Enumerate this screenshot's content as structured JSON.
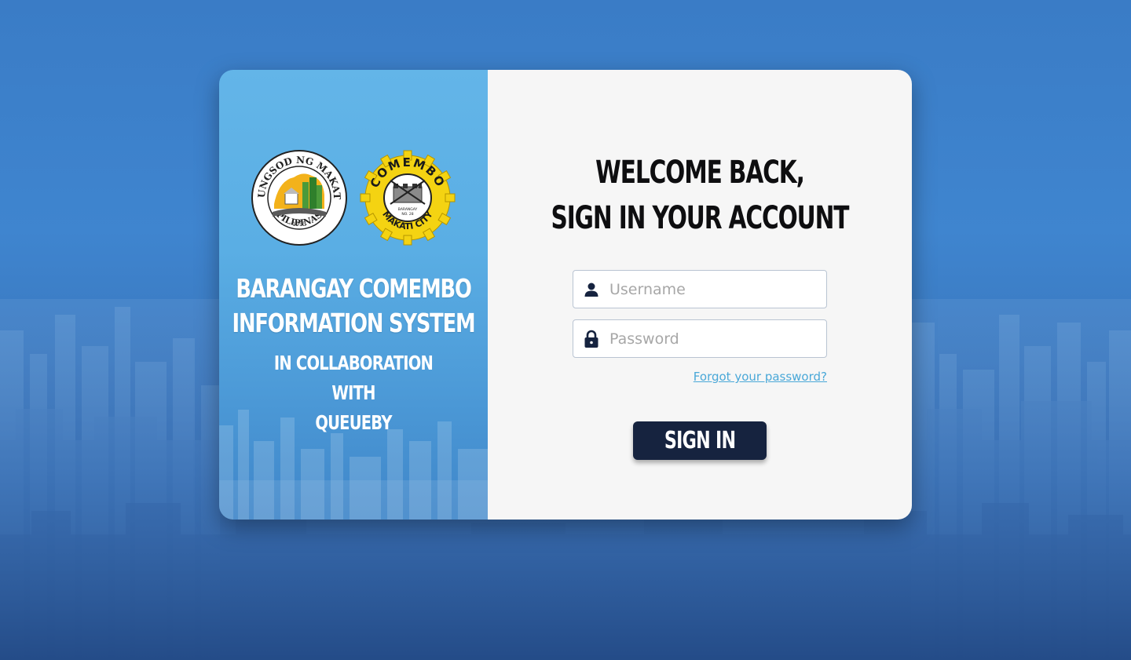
{
  "brand": {
    "title_line1": "BARANGAY COMEMBO",
    "title_line2": "INFORMATION SYSTEM",
    "subtitle_line1": "IN COLLABORATION WITH",
    "subtitle_line2": "QUEUEBY"
  },
  "logos": {
    "makati_seal": {
      "top_text": "LUNGSOD NG MAKATI",
      "bottom_text": "PILIPINAS",
      "year": "1995"
    },
    "comembo_seal": {
      "top_text": "COMEMBO",
      "bottom_text": "MAKATI CITY",
      "center_text": "BARANGAY",
      "center_sub": "NO. 28"
    }
  },
  "login": {
    "heading_line1": "WELCOME BACK,",
    "heading_line2": "SIGN IN YOUR ACCOUNT",
    "username_placeholder": "Username",
    "password_placeholder": "Password",
    "forgot_label": "Forgot your password?",
    "signin_label": "SIGN IN"
  },
  "icons": {
    "username": "user-icon",
    "password": "lock-icon"
  },
  "colors": {
    "left_panel": "#5aaee4",
    "right_panel": "#f6f6f6",
    "button": "#16233f",
    "link": "#4aa8d8",
    "seal_yellow": "#f4d312"
  }
}
